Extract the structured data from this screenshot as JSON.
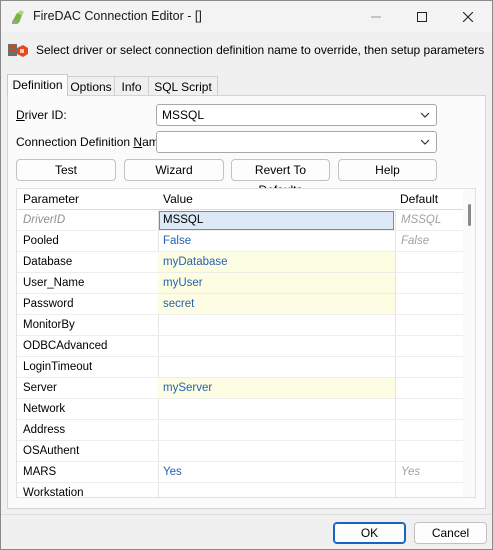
{
  "window": {
    "title": "FireDAC Connection Editor - []",
    "min_icon": "minimize-icon",
    "max_icon": "maximize-icon",
    "close_icon": "close-icon"
  },
  "banner": {
    "text": "Select driver or select connection definition name to override, then setup parameters",
    "icon": "connection-icon"
  },
  "tabs": [
    {
      "label": "Definition",
      "active": true
    },
    {
      "label": "Options",
      "active": false
    },
    {
      "label": "Info",
      "active": false
    },
    {
      "label": "SQL Script",
      "active": false
    }
  ],
  "form": {
    "driver_label_pre": "",
    "driver_label_ul": "D",
    "driver_label_post": "river ID:",
    "driver_value": "MSSQL",
    "conn_label_pre": "Connection Definition ",
    "conn_label_ul": "N",
    "conn_label_post": "ame:",
    "conn_value": ""
  },
  "actions": {
    "test": "Test",
    "wizard": "Wizard",
    "revert": "Revert To Defaults",
    "help": "Help"
  },
  "grid": {
    "headers": {
      "parameter": "Parameter",
      "value": "Value",
      "default": "Default"
    },
    "rows": [
      {
        "param": "DriverID",
        "value": "MSSQL",
        "default": "MSSQL"
      },
      {
        "param": "Pooled",
        "value": "False",
        "default": "False"
      },
      {
        "param": "Database",
        "value": "myDatabase",
        "default": ""
      },
      {
        "param": "User_Name",
        "value": "myUser",
        "default": ""
      },
      {
        "param": "Password",
        "value": "secret",
        "default": ""
      },
      {
        "param": "MonitorBy",
        "value": "",
        "default": ""
      },
      {
        "param": "ODBCAdvanced",
        "value": "",
        "default": ""
      },
      {
        "param": "LoginTimeout",
        "value": "",
        "default": ""
      },
      {
        "param": "Server",
        "value": "myServer",
        "default": ""
      },
      {
        "param": "Network",
        "value": "",
        "default": ""
      },
      {
        "param": "Address",
        "value": "",
        "default": ""
      },
      {
        "param": "OSAuthent",
        "value": "",
        "default": ""
      },
      {
        "param": "MARS",
        "value": "Yes",
        "default": "Yes"
      },
      {
        "param": "Workstation",
        "value": "",
        "default": ""
      }
    ]
  },
  "footer": {
    "ok": "OK",
    "cancel": "Cancel"
  },
  "colors": {
    "value_text": "#2563b0",
    "value_highlight": "#fdfde3",
    "selected_cell": "#dde9f7",
    "default_button_border": "#1a62c5"
  }
}
